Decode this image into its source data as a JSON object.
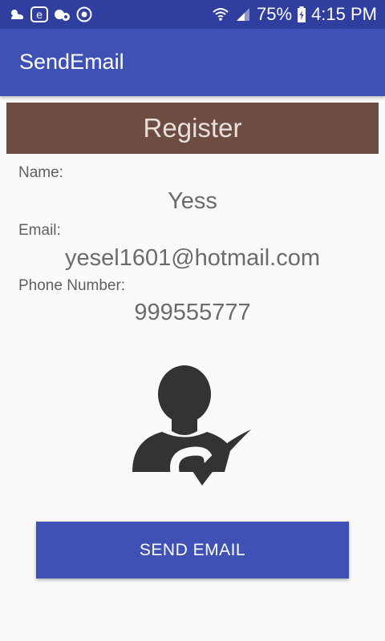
{
  "status_bar": {
    "battery": "75%",
    "time": "4:15 PM",
    "left_icons": [
      "weather-icon",
      "browser-icon",
      "notification-icon",
      "chrome-icon"
    ],
    "right_icons": [
      "wifi-icon",
      "signal-icon",
      "battery-icon"
    ]
  },
  "app_bar": {
    "title": "SendEmail"
  },
  "header": {
    "title": "Register"
  },
  "form": {
    "name_label": "Name:",
    "name_value": "Yess",
    "email_label": "Email:",
    "email_value": "yesel1601@hotmail.com",
    "phone_label": "Phone Number:",
    "phone_value": "999555777"
  },
  "illustration": {
    "icon": "user-check-icon"
  },
  "actions": {
    "send_label": "SEND EMAIL"
  },
  "colors": {
    "status_bar": "#303f9f",
    "app_bar": "#3f51b5",
    "header": "#6d4c41",
    "button": "#3f51b5",
    "background": "#fafafa"
  }
}
